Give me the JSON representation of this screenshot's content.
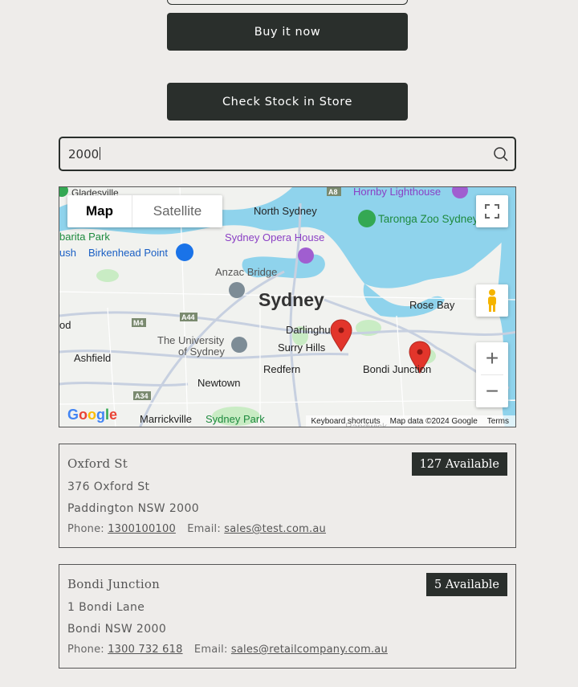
{
  "buttons": {
    "buy_now": "Buy it now",
    "check_stock": "Check Stock in Store"
  },
  "search": {
    "value": "2000",
    "icon": "search-icon"
  },
  "map": {
    "type_controls": {
      "map": "Map",
      "satellite": "Satellite",
      "selected": "Map"
    },
    "labels": {
      "gladesville": "Gladesville",
      "north_sydney": "North Sydney",
      "hornby": "Hornby Lighthouse",
      "taronga": "Taronga Zoo Sydney",
      "barita": "barita Park",
      "birkenhead": "Birkenhead Point",
      "ush": "ush",
      "opera": "Sydney Opera House",
      "anzac": "Anzac Bridge",
      "sydney": "Sydney",
      "darlinghurst": "Darlinghu",
      "rosebay": "Rose Bay",
      "od": "od",
      "uni1": "The University",
      "uni2": "of Sydney",
      "surry": "Surry Hills",
      "ashfield": "Ashfield",
      "redfern": "Redfern",
      "bondi": "Bondi Junction",
      "newtown": "Newtown",
      "marrickville": "Marrickville",
      "sydneypark": "Sydney Park",
      "randwick": "Randwick",
      "road_a8": "A8",
      "road_m4": "M4",
      "road_a44": "A44",
      "road_a34": "A34"
    },
    "footer": {
      "shortcuts": "Keyboard shortcuts",
      "data": "Map data ©2024 Google",
      "terms": "Terms"
    },
    "logo": "Google",
    "zoom_in": "+",
    "zoom_out": "−"
  },
  "stores": [
    {
      "name": "Oxford St",
      "availability": "127 Available",
      "address1": "376 Oxford St",
      "address2": "Paddington NSW 2000",
      "phone_label": "Phone:",
      "phone": "1300100100",
      "email_label": "Email:",
      "email": "sales@test.com.au"
    },
    {
      "name": "Bondi Junction",
      "availability": "5 Available",
      "address1": "1 Bondi Lane",
      "address2": "Bondi NSW 2000",
      "phone_label": "Phone:",
      "phone": "1300 732 618",
      "email_label": "Email:",
      "email": "sales@retailcompany.com.au"
    }
  ],
  "colors": {
    "dark_button": "#2a2f2c",
    "background": "#eeecea",
    "water": "#8fd3ec",
    "pin": "#e2352b"
  }
}
